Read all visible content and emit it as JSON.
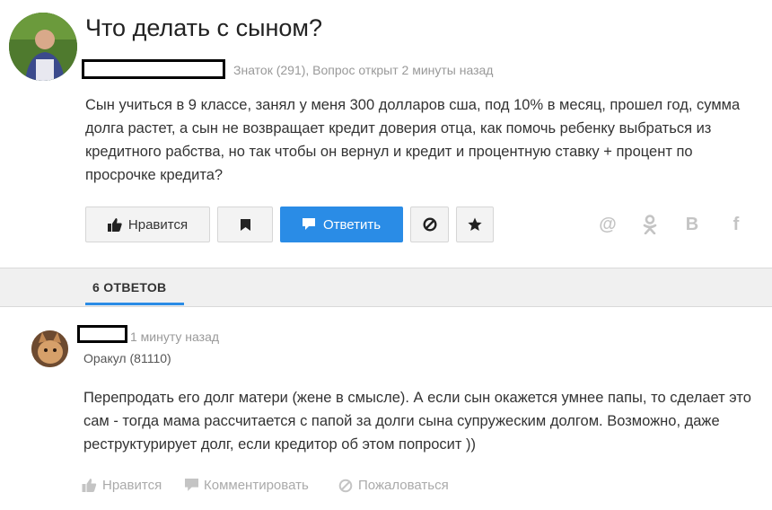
{
  "question": {
    "title": "Что делать с сыном?",
    "author_meta": "Знаток (291), Вопрос открыт 2 минуты назад",
    "text": "Сын учиться в 9 классе, занял у меня 300 долларов сша, под 10% в месяц, прошел год, сумма долга растет, а сын не возвращает кредит доверия отца, как помочь ребенку выбраться из кредитного рабства, но так чтобы он вернул и кредит и процентную ставку + процент по просрочке кредита?"
  },
  "actions": {
    "like_label": "Нравится",
    "answer_label": "Ответить"
  },
  "share": {
    "mail": "@",
    "vk": "B",
    "facebook": "f"
  },
  "tabs": {
    "answers_label": "6 ОТВЕТОВ"
  },
  "answer": {
    "time": "1 минуту назад",
    "rank": "Оракул (81110)",
    "text": "Перепродать его долг матери (жене в смысле). А если сын окажется умнее папы, то сделает это сам - тогда мама рассчитается с папой за долги сына супружеским долгом. Возможно, даже реструктурирует долг, если кредитор об этом попросит ))",
    "like_label": "Нравится",
    "comment_label": "Комментировать",
    "report_label": "Пожаловаться"
  },
  "colors": {
    "accent": "#2a8ce6",
    "muted_text": "#999999",
    "icon_gray": "#c4c4c4"
  }
}
